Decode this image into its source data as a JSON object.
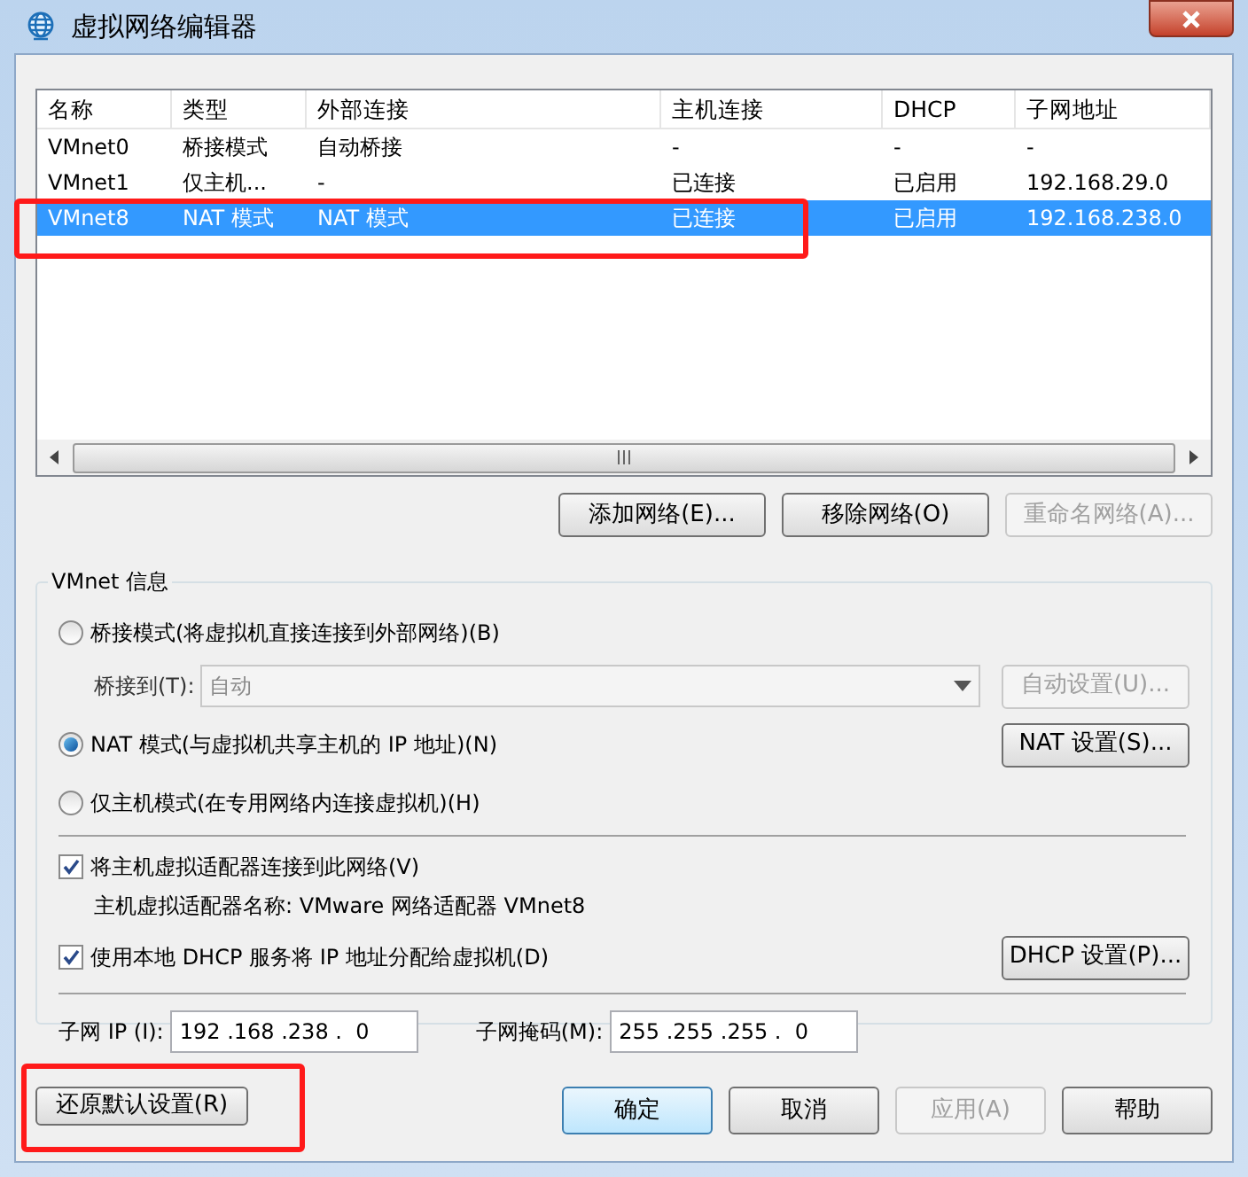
{
  "window": {
    "title": "虚拟网络编辑器"
  },
  "table": {
    "columns": [
      "名称",
      "类型",
      "外部连接",
      "主机连接",
      "DHCP",
      "子网地址"
    ],
    "rows": [
      {
        "cells": [
          "VMnet0",
          "桥接模式",
          "自动桥接",
          "-",
          "-",
          "-"
        ],
        "selected": false,
        "annotated": false
      },
      {
        "cells": [
          "VMnet1",
          "仅主机...",
          "-",
          "已连接",
          "已启用",
          "192.168.29.0"
        ],
        "selected": false,
        "annotated": false
      },
      {
        "cells": [
          "VMnet8",
          "NAT 模式",
          "NAT 模式",
          "已连接",
          "已启用",
          "192.168.238.0"
        ],
        "selected": true,
        "annotated": true
      }
    ]
  },
  "list_buttons": [
    {
      "label": "添加网络(E)...",
      "disabled": false
    },
    {
      "label": "移除网络(O)",
      "disabled": false
    },
    {
      "label": "重命名网络(A)...",
      "disabled": true
    }
  ],
  "vmnet_info": {
    "title": "VMnet 信息",
    "modes": [
      {
        "label": "桥接模式(将虚拟机直接连接到外部网络)(B)",
        "selected": false
      },
      {
        "label": "NAT 模式(与虚拟机共享主机的 IP 地址)(N)",
        "selected": true
      },
      {
        "label": "仅主机模式(在专用网络内连接虚拟机)(H)",
        "selected": false
      }
    ],
    "bridge_to": {
      "label": "桥接到(T):",
      "value": "自动",
      "disabled": true
    },
    "auto_settings_button": {
      "label": "自动设置(U)...",
      "disabled": true
    },
    "nat_settings_button": {
      "label": "NAT 设置(S)...",
      "disabled": false
    },
    "connect_adapter": {
      "label": "将主机虚拟适配器连接到此网络(V)",
      "checked": true
    },
    "adapter_name": "主机虚拟适配器名称: VMware 网络适配器 VMnet8",
    "use_dhcp": {
      "label": "使用本地 DHCP 服务将 IP 地址分配给虚拟机(D)",
      "checked": true
    },
    "dhcp_settings_button": {
      "label": "DHCP 设置(P)...",
      "disabled": false
    },
    "subnet_ip": {
      "label": "子网 IP (I):",
      "value": "192 .168 .238 .  0"
    },
    "subnet_mask": {
      "label": "子网掩码(M):",
      "value": "255 .255 .255 .  0"
    }
  },
  "footer_buttons": [
    {
      "label": "还原默认设置(R)",
      "disabled": false,
      "default": false,
      "annotated": true
    },
    {
      "label": "确定",
      "disabled": false,
      "default": true,
      "annotated": false
    },
    {
      "label": "取消",
      "disabled": false,
      "default": false,
      "annotated": false
    },
    {
      "label": "应用(A)",
      "disabled": true,
      "default": false,
      "annotated": false
    },
    {
      "label": "帮助",
      "disabled": false,
      "default": false,
      "annotated": false
    }
  ]
}
